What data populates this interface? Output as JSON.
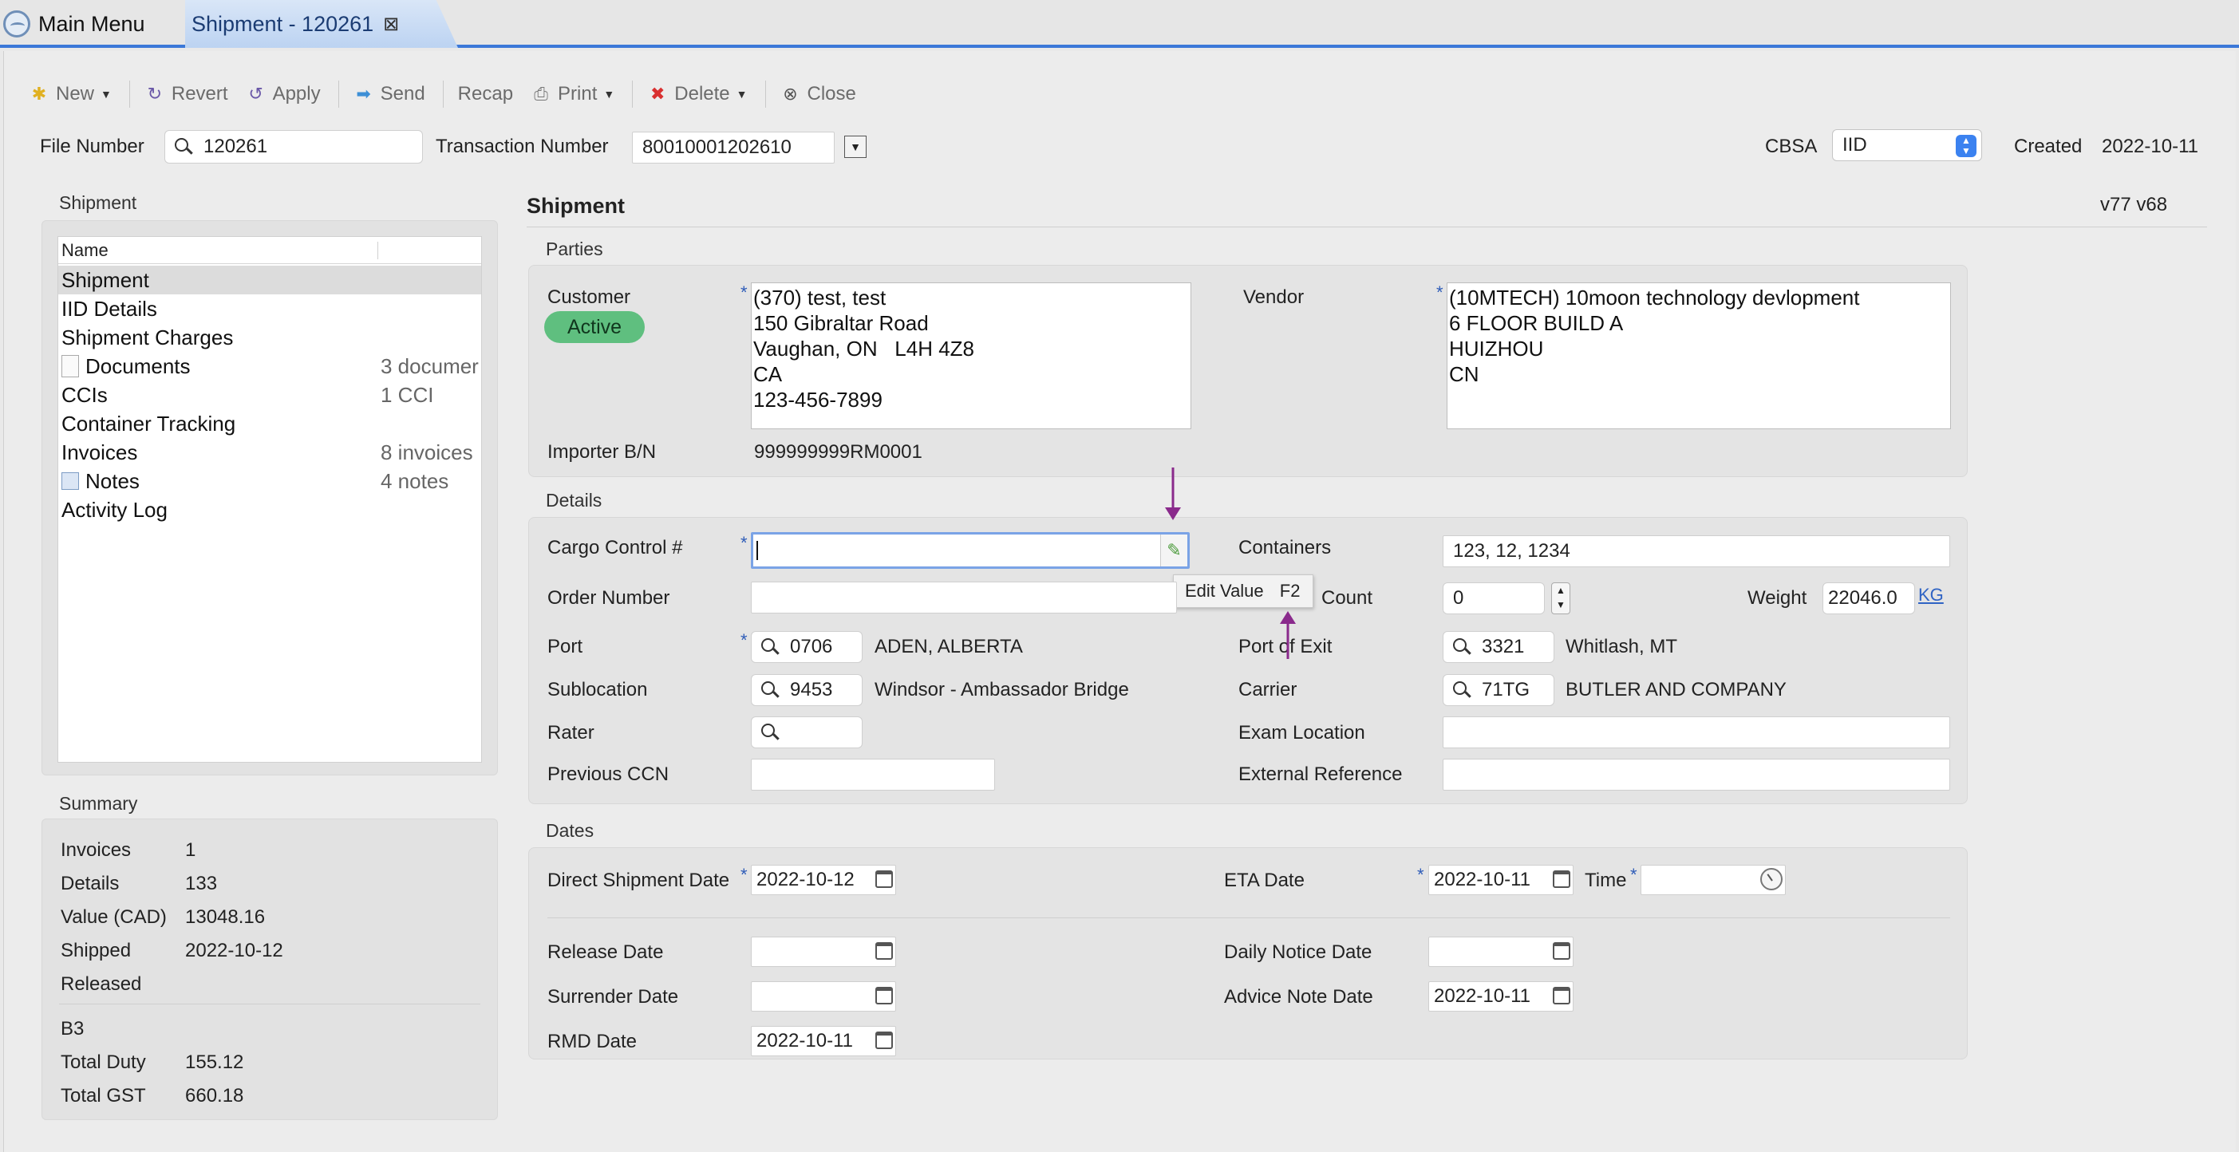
{
  "tabs": [
    {
      "label": "Main Menu"
    },
    {
      "label": "Shipment - 120261"
    }
  ],
  "toolbar": {
    "new": "New",
    "revert": "Revert",
    "apply": "Apply",
    "send": "Send",
    "recap": "Recap",
    "print": "Print",
    "delete": "Delete",
    "close": "Close"
  },
  "header": {
    "file_number_label": "File Number",
    "file_number": "120261",
    "transaction_label": "Transaction Number",
    "transaction_number": "80010001202610",
    "cbsa_label": "CBSA",
    "cbsa_value": "IID",
    "created_label": "Created",
    "created_value": "2022-10-11"
  },
  "left": {
    "shipment_title": "Shipment",
    "tree_header": "Name",
    "tree": [
      {
        "label": "Shipment",
        "count": ""
      },
      {
        "label": "IID Details",
        "count": ""
      },
      {
        "label": "Shipment Charges",
        "count": ""
      },
      {
        "label": "Documents",
        "count": "3 documer"
      },
      {
        "label": "CCIs",
        "count": "1 CCI"
      },
      {
        "label": "Container Tracking",
        "count": ""
      },
      {
        "label": "Invoices",
        "count": "8 invoices"
      },
      {
        "label": "Notes",
        "count": "4 notes"
      },
      {
        "label": "Activity Log",
        "count": ""
      }
    ],
    "summary_title": "Summary",
    "summary": {
      "invoices_label": "Invoices",
      "invoices": "1",
      "details_label": "Details",
      "details": "133",
      "value_label": "Value (CAD)",
      "value": "13048.16",
      "shipped_label": "Shipped",
      "shipped": "2022-10-12",
      "released_label": "Released",
      "b3_label": "B3",
      "total_duty_label": "Total Duty",
      "total_duty": "155.12",
      "total_gst_label": "Total GST",
      "total_gst": "660.18"
    }
  },
  "main": {
    "title": "Shipment",
    "version": "v77 v68",
    "parties_title": "Parties",
    "customer_label": "Customer",
    "customer_status": "Active",
    "customer_lines": [
      "(370) test, test",
      "150 Gibraltar Road",
      "Vaughan, ON   L4H 4Z8",
      "CA",
      "123-456-7899"
    ],
    "vendor_label": "Vendor",
    "vendor_lines": [
      "(10MTECH) 10moon technology devlopment",
      "6 FLOOR BUILD A",
      "HUIZHOU",
      "CN"
    ],
    "importer_label": "Importer B/N",
    "importer_value": "999999999RM0001",
    "details_title": "Details",
    "cargo_label": "Cargo Control #",
    "cargo_value": "",
    "tooltip_label": "Edit Value",
    "tooltip_key": "F2",
    "containers_label": "Containers",
    "containers_value": "123, 12, 1234",
    "order_label": "Order Number",
    "order_value": "",
    "count_label": "Count",
    "count_value": "0",
    "weight_label": "Weight",
    "weight_value": "22046.0",
    "weight_unit": "KG",
    "port_label": "Port",
    "port_code": "0706",
    "port_name": "ADEN, ALBERTA",
    "port_exit_label": "Port of Exit",
    "port_exit_code": "3321",
    "port_exit_name": "Whitlash, MT",
    "subloc_label": "Sublocation",
    "subloc_code": "9453",
    "subloc_name": "Windsor - Ambassador Bridge",
    "carrier_label": "Carrier",
    "carrier_code": "71TG",
    "carrier_name": "BUTLER AND COMPANY",
    "rater_label": "Rater",
    "rater_value": "",
    "exam_label": "Exam Location",
    "exam_value": "",
    "prev_ccn_label": "Previous CCN",
    "prev_ccn_value": "",
    "ext_ref_label": "External Reference",
    "ext_ref_value": "",
    "dates_title": "Dates",
    "direct_label": "Direct Shipment Date",
    "direct_value": "2022-10-12",
    "eta_label": "ETA Date",
    "eta_value": "2022-10-11",
    "time_label": "Time",
    "time_value": "",
    "release_label": "Release Date",
    "release_value": "",
    "daily_label": "Daily Notice Date",
    "daily_value": "",
    "surrender_label": "Surrender Date",
    "surrender_value": "",
    "advice_label": "Advice Note Date",
    "advice_value": "2022-10-11",
    "rmd_label": "RMD Date",
    "rmd_value": "2022-10-11"
  },
  "colors": {
    "accent": "#3b78d8",
    "active_badge": "#5fbf7f",
    "annotation_arrow": "#8a2a8c",
    "required_star": "#2e5cb8"
  }
}
